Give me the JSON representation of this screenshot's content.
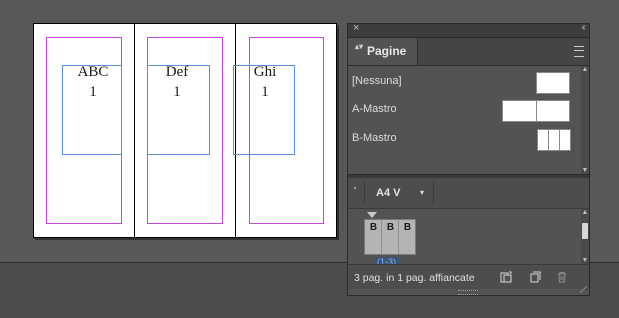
{
  "document": {
    "pages": [
      {
        "text_line1": "ABC",
        "text_line2": "1"
      },
      {
        "text_line1": "Def",
        "text_line2": "1"
      },
      {
        "text_line1": "Ghi",
        "text_line2": "1"
      }
    ]
  },
  "panel": {
    "close_glyph": "×",
    "collapse_glyph": "‹‹",
    "tab_arrows_glyph": "▴▾",
    "tab_title": "Pagine",
    "masters": [
      {
        "label": "[Nessuna]"
      },
      {
        "label": "A-Mastro"
      },
      {
        "label": "B-Mastro"
      }
    ],
    "page_size": "A4 V",
    "page_size_dropdown_glyph": "▾",
    "spread": {
      "letters": [
        "B",
        "B",
        "B"
      ],
      "pages_label": "(1-3)"
    },
    "status": "3 pag. in 1 pag. affiancate",
    "icons": {
      "menu": "panel-menu-icon",
      "edit_size": "edit-page-size-icon",
      "new_page": "new-page-icon",
      "trash": "trash-icon"
    }
  },
  "colors": {
    "margin_guide": "#c34ad6",
    "text_frame": "#5d8fd6",
    "panel_bg": "#535353",
    "canvas_bg": "#585858"
  }
}
